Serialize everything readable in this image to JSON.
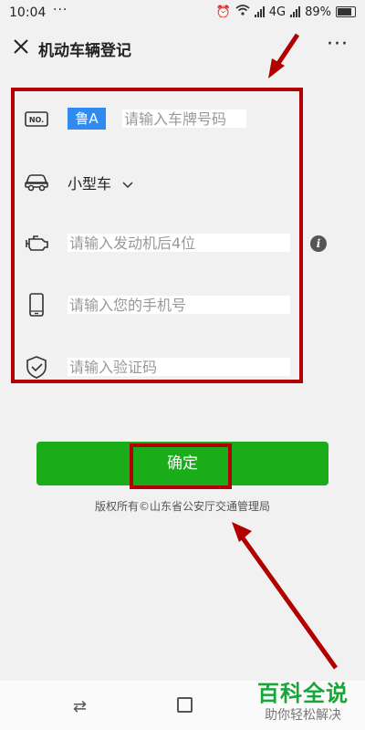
{
  "status_bar": {
    "time": "10:04",
    "dots": "···",
    "network": "4G",
    "battery": "89%"
  },
  "nav": {
    "title": "机动车辆登记",
    "more": "···"
  },
  "form": {
    "plate_prefix": "鲁A",
    "plate_placeholder": "请输入车牌号码",
    "vehicle_type": "小型车",
    "engine_placeholder": "请输入发动机后4位",
    "phone_placeholder": "请输入您的手机号",
    "code_placeholder": "请输入验证码"
  },
  "confirm_label": "确定",
  "copyright": "版权所有©山东省公安厅交通管理局",
  "watermark": {
    "title": "百科全说",
    "subtitle": "助你轻松解决"
  },
  "colors": {
    "accent_green": "#1aad19",
    "badge_blue": "#2f8bf0",
    "annotation_red": "#b00000"
  }
}
